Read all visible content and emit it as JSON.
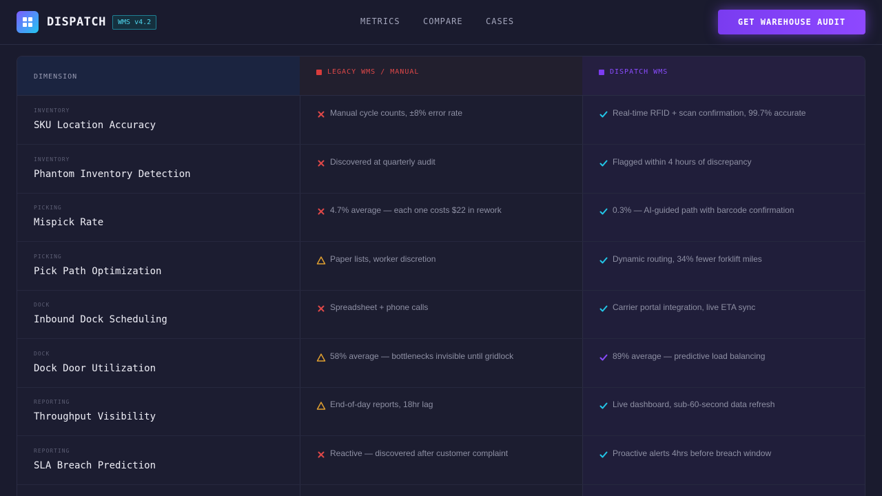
{
  "header": {
    "brand": "DISPATCH",
    "version": "WMS v4.2",
    "nav": [
      "METRICS",
      "COMPARE",
      "CASES"
    ],
    "cta": "GET WAREHOUSE AUDIT",
    "logo_icon": "grid-icon"
  },
  "table": {
    "headers": [
      "DIMENSION",
      "LEGACY WMS / MANUAL",
      "DISPATCH WMS"
    ],
    "colors": {
      "legacy": "#d83c3c",
      "dispatch": "#7c3cf0",
      "cross": "#e04848",
      "warn": "#e0a030",
      "check": "#22c7e8",
      "check_alt": "#8a4cff"
    },
    "rows": [
      {
        "category": "INVENTORY",
        "dimension": "SKU Location Accuracy",
        "legacy_status": "cross",
        "legacy": "Manual cycle counts, ±8% error rate",
        "dispatch_status": "check",
        "dispatch": "Real-time RFID + scan confirmation, 99.7% accurate"
      },
      {
        "category": "INVENTORY",
        "dimension": "Phantom Inventory Detection",
        "legacy_status": "cross",
        "legacy": "Discovered at quarterly audit",
        "dispatch_status": "check",
        "dispatch": "Flagged within 4 hours of discrepancy"
      },
      {
        "category": "PICKING",
        "dimension": "Mispick Rate",
        "legacy_status": "cross",
        "legacy": "4.7% average — each one costs $22 in rework",
        "dispatch_status": "check",
        "dispatch": "0.3% — AI-guided path with barcode confirmation"
      },
      {
        "category": "PICKING",
        "dimension": "Pick Path Optimization",
        "legacy_status": "warn",
        "legacy": "Paper lists, worker discretion",
        "dispatch_status": "check",
        "dispatch": "Dynamic routing, 34% fewer forklift miles"
      },
      {
        "category": "DOCK",
        "dimension": "Inbound Dock Scheduling",
        "legacy_status": "cross",
        "legacy": "Spreadsheet + phone calls",
        "dispatch_status": "check",
        "dispatch": "Carrier portal integration, live ETA sync"
      },
      {
        "category": "DOCK",
        "dimension": "Dock Door Utilization",
        "legacy_status": "warn",
        "legacy": "58% average — bottlenecks invisible until gridlock",
        "dispatch_status": "check_alt",
        "dispatch": "89% average — predictive load balancing"
      },
      {
        "category": "REPORTING",
        "dimension": "Throughput Visibility",
        "legacy_status": "warn",
        "legacy": "End-of-day reports, 18hr lag",
        "dispatch_status": "check",
        "dispatch": "Live dashboard, sub-60-second data refresh"
      },
      {
        "category": "REPORTING",
        "dimension": "SLA Breach Prediction",
        "legacy_status": "cross",
        "legacy": "Reactive — discovered after customer complaint",
        "dispatch_status": "check",
        "dispatch": "Proactive alerts 4hrs before breach window"
      }
    ]
  }
}
